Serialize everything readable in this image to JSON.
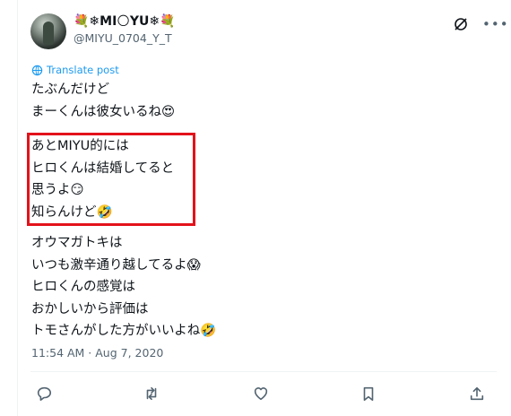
{
  "post": {
    "author_name": "💐❄MI🌕YU❄💐",
    "author_handle": "@MIYU_0704_Y_T",
    "translate_label": "Translate post",
    "paragraph1": [
      "たぶんだけど",
      "まーくんは彼女いるね😍"
    ],
    "paragraph2": [
      "あとMIYU的には",
      "ヒロくんは結婚してると",
      "思うよ😏",
      "知らんけど🤣"
    ],
    "paragraph3": [
      "オウマガトキは",
      "いつも激辛通り越してるよ😱",
      "ヒロくんの感覚は",
      "おかしいから評価は",
      "トモさんがした方がいいよね🤣"
    ],
    "timestamp": "11:54 AM · Aug 7, 2020",
    "highlight_color": "#e3121b"
  },
  "actions": [
    {
      "name": "reply-icon"
    },
    {
      "name": "repost-icon"
    },
    {
      "name": "like-icon"
    },
    {
      "name": "bookmark-icon"
    },
    {
      "name": "share-icon"
    }
  ],
  "colors": {
    "text": "#0f1419",
    "muted": "#536471",
    "link": "#1d9bf0"
  }
}
